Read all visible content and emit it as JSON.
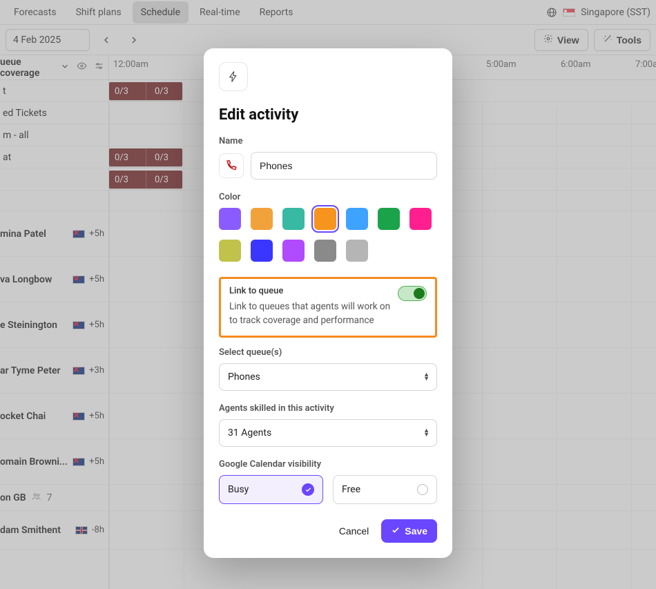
{
  "nav": {
    "tabs": [
      {
        "label": "Forecasts"
      },
      {
        "label": "Shift plans"
      },
      {
        "label": "Schedule",
        "active": true
      },
      {
        "label": "Real-time"
      },
      {
        "label": "Reports"
      }
    ],
    "region": "Singapore (SST)"
  },
  "toolbar": {
    "date": "4 Feb 2025",
    "view_label": "View",
    "tools_label": "Tools"
  },
  "schedule": {
    "header": {
      "title": "ueue coverage",
      "times": [
        "12:00am",
        "5:00am",
        "6:00am",
        "7:00a"
      ]
    },
    "queues": [
      {
        "name": "t"
      },
      {
        "name": "ed Tickets"
      },
      {
        "name": "m - all"
      },
      {
        "name": "at"
      }
    ],
    "bars": {
      "seg1": "0/3",
      "seg2": "0/3"
    },
    "agents": [
      {
        "name": "mina Patel",
        "flag": "au",
        "offset": "+5h"
      },
      {
        "name": "va Longbow",
        "flag": "au",
        "offset": "+5h"
      },
      {
        "name": "e Steinington",
        "flag": "au",
        "offset": "+5h"
      },
      {
        "name": "ar Tyme Peter",
        "flag": "au",
        "offset": "+3h"
      },
      {
        "name": "ocket Chai",
        "flag": "au",
        "offset": "+5h"
      },
      {
        "name": "omain Browni...",
        "flag": "au",
        "offset": "+5h"
      }
    ],
    "group": {
      "name": "on GB",
      "count": "7"
    },
    "last_agent": {
      "name": "dam Smithent",
      "flag": "gb",
      "offset": "-8h"
    }
  },
  "modal": {
    "title": "Edit activity",
    "name_label": "Name",
    "name_value": "Phones",
    "color_label": "Color",
    "colors": [
      "#8a5cff",
      "#f2a23a",
      "#37b9a3",
      "#f7941d",
      "#3ea2ff",
      "#1aa34a",
      "#ff1f8f",
      "#c0c24b",
      "#3a36ff",
      "#b04bff",
      "#8a8a8a",
      "#b5b5b5"
    ],
    "selected_color_index": 3,
    "link": {
      "title": "Link to queue",
      "desc": "Link to queues that agents will work on to track coverage and performance",
      "on": true
    },
    "select_queue_label": "Select queue(s)",
    "select_queue_value": "Phones",
    "agents_label": "Agents skilled in this activity",
    "agents_value": "31 Agents",
    "gcal_label": "Google Calendar visibility",
    "busy": "Busy",
    "free": "Free",
    "cancel": "Cancel",
    "save": "Save"
  }
}
